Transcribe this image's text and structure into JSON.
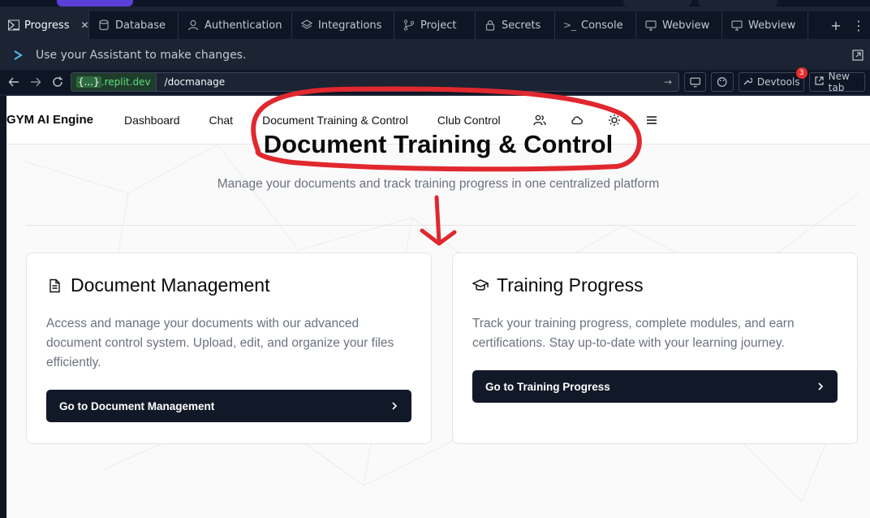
{
  "tabs": [
    {
      "label": "Progress",
      "icon": "progress-icon",
      "active": true
    },
    {
      "label": "Database",
      "icon": "database-icon"
    },
    {
      "label": "Authentication",
      "icon": "user-icon"
    },
    {
      "label": "Integrations",
      "icon": "layers-icon"
    },
    {
      "label": "Project",
      "icon": "branch-icon"
    },
    {
      "label": "Secrets",
      "icon": "lock-icon"
    },
    {
      "label": "Console",
      "icon": "terminal-icon"
    },
    {
      "label": "Webview",
      "icon": "monitor-icon"
    },
    {
      "label": "Webview",
      "icon": "monitor-icon"
    }
  ],
  "assistant": {
    "text": "Use your Assistant to make changes."
  },
  "browser": {
    "host_badge": "{...}",
    "host_suffix": ".replit.dev",
    "path": "/docmanage",
    "devtools_label": "Devtools",
    "devtools_count": "3",
    "newtab_label": "New tab"
  },
  "app": {
    "brand": "GYM AI Engine",
    "nav": [
      "Dashboard",
      "Chat",
      "Document Training & Control",
      "Club Control"
    ],
    "title": "Document Training & Control",
    "subtitle": "Manage your documents and track training progress in one centralized platform",
    "cards": [
      {
        "title": "Document Management",
        "icon": "document-icon",
        "description": "Access and manage your documents with our advanced document control system. Upload, edit, and organize your files efficiently.",
        "button": "Go to Document Management"
      },
      {
        "title": "Training Progress",
        "icon": "graduation-cap-icon",
        "description": "Track your training progress, complete modules, and earn certifications. Stay up-to-date with your learning journey.",
        "button": "Go to Training Progress"
      }
    ]
  },
  "colors": {
    "annotation": "#e0282e",
    "accent_dark": "#111827"
  }
}
